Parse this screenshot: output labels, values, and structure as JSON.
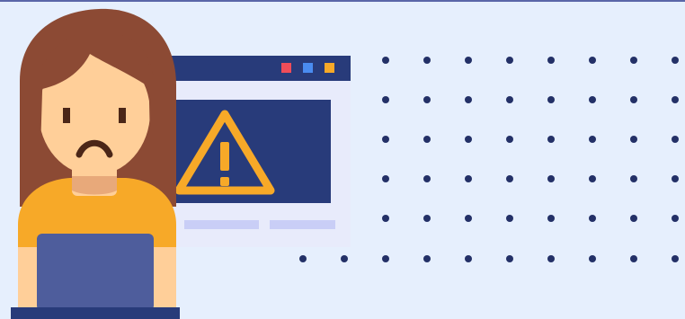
{
  "illustration": {
    "subject": "user-with-browser-warning",
    "icons": [
      "warning-icon"
    ],
    "colors": {
      "background": "#e6effd",
      "window_bar": "#283b7a",
      "window_body": "#e8ebfb",
      "warning_panel": "#283b7a",
      "warning_symbol": "#f7a928",
      "dot": "#233067",
      "hair": "#8c4a34",
      "skin": "#ffcf99",
      "shirt": "#f7a928",
      "laptop": "#4e5d9c",
      "desk": "#283b7a",
      "window_button_red": "#ef4d59",
      "window_button_blue": "#4a8cf0",
      "window_button_orange": "#f7a928"
    }
  }
}
